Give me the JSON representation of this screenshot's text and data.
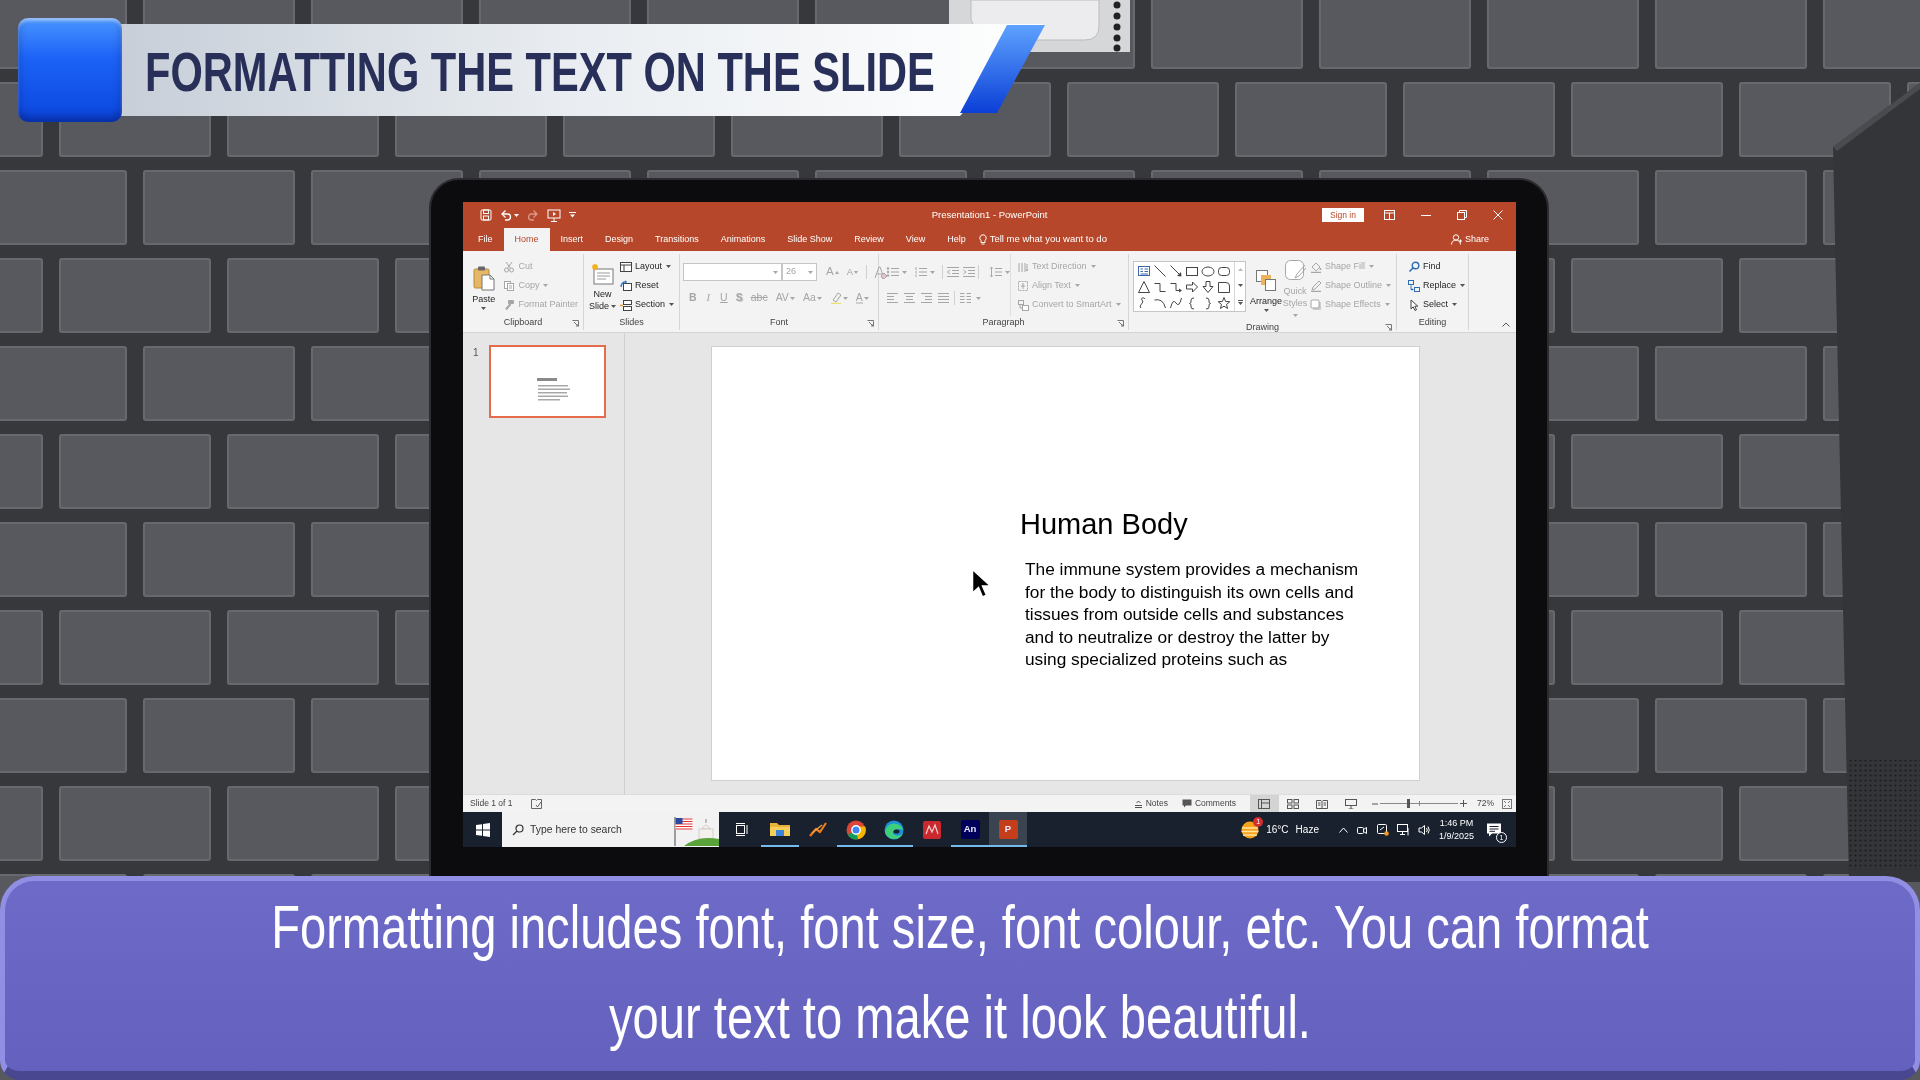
{
  "banner": {
    "title": "FORMATTING THE TEXT ON THE SLIDE"
  },
  "window": {
    "title": "Presentation1 - PowerPoint",
    "quick_access": [
      {
        "kind": "save",
        "disabled": false
      },
      {
        "kind": "undo",
        "disabled": false
      },
      {
        "kind": "redo",
        "disabled": true
      },
      {
        "kind": "present",
        "disabled": false
      },
      {
        "kind": "customize",
        "disabled": false
      }
    ],
    "sign_in": "Sign in",
    "tell_me": "Tell me what you want to do",
    "share": "Share"
  },
  "tabs": [
    {
      "label": "File",
      "selected": false
    },
    {
      "label": "Home",
      "selected": true
    },
    {
      "label": "Insert",
      "selected": false
    },
    {
      "label": "Design",
      "selected": false
    },
    {
      "label": "Transitions",
      "selected": false
    },
    {
      "label": "Animations",
      "selected": false
    },
    {
      "label": "Slide Show",
      "selected": false
    },
    {
      "label": "Review",
      "selected": false
    },
    {
      "label": "View",
      "selected": false
    },
    {
      "label": "Help",
      "selected": false
    }
  ],
  "ribbon": {
    "clipboard": {
      "label": "Clipboard",
      "launcher": true,
      "paste": {
        "label": "Paste",
        "disabled": false
      },
      "items": [
        {
          "kind": "cut",
          "label": "Cut",
          "disabled": true
        },
        {
          "kind": "copy",
          "label": "Copy",
          "disabled": true
        },
        {
          "kind": "painter",
          "label": "Format Painter",
          "disabled": true
        }
      ]
    },
    "slides": {
      "label": "Slides",
      "launcher": false,
      "new_slide": {
        "label": "New Slide",
        "disabled": false
      },
      "items": [
        {
          "kind": "layout",
          "label": "Layout",
          "disabled": false
        },
        {
          "kind": "reset",
          "label": "Reset",
          "disabled": false
        },
        {
          "kind": "section",
          "label": "Section",
          "disabled": false
        }
      ]
    },
    "font": {
      "label": "Font",
      "launcher": true,
      "disabled": true,
      "font_size": "26",
      "size_buttons": [
        {
          "kind": "grow",
          "glyph": "A"
        },
        {
          "kind": "shrink",
          "glyph": "A"
        }
      ],
      "buttons": [
        {
          "kind": "bold",
          "glyph": "B"
        },
        {
          "kind": "italic",
          "glyph": "I"
        },
        {
          "kind": "underline",
          "glyph": "U"
        },
        {
          "kind": "shadow",
          "glyph": "S"
        },
        {
          "kind": "strike",
          "glyph": "abc"
        },
        {
          "kind": "spacing",
          "glyph": "AV"
        },
        {
          "kind": "case",
          "glyph": "Aa"
        },
        {
          "kind": "highlight"
        },
        {
          "kind": "color",
          "glyph": "A"
        }
      ]
    },
    "paragraph": {
      "label": "Paragraph",
      "launcher": true,
      "disabled": true,
      "items": [
        {
          "kind": "direction",
          "label": "Text Direction"
        },
        {
          "kind": "align",
          "label": "Align Text"
        },
        {
          "kind": "smartart",
          "label": "Convert to SmartArt"
        }
      ]
    },
    "drawing": {
      "label": "Drawing",
      "launcher": true,
      "arrange": {
        "label": "Arrange",
        "disabled": false
      },
      "quick_styles": {
        "label": "Quick Styles",
        "disabled": true
      },
      "items": [
        {
          "kind": "fill",
          "label": "Shape Fill",
          "disabled": true
        },
        {
          "kind": "outline",
          "label": "Shape Outline",
          "disabled": true
        },
        {
          "kind": "effects",
          "label": "Shape Effects",
          "disabled": true
        }
      ]
    },
    "editing": {
      "label": "Editing",
      "launcher": false,
      "items": [
        {
          "kind": "find",
          "label": "Find",
          "disabled": false
        },
        {
          "kind": "replace",
          "label": "Replace",
          "disabled": false
        },
        {
          "kind": "select",
          "label": "Select",
          "disabled": false
        }
      ]
    }
  },
  "thumbnails": [
    {
      "number": "1",
      "selected": true
    }
  ],
  "slide": {
    "title": "Human Body",
    "body": "The immune system provides a mechanism for the body to distinguish its own cells and tissues from outside cells and substances and to neutralize or destroy the latter by using specialized proteins such as"
  },
  "status_bar": {
    "slide_info": "Slide 1 of 1",
    "notes": "Notes",
    "comments": "Comments",
    "views": [
      {
        "kind": "normal",
        "selected": true
      },
      {
        "kind": "sorter",
        "selected": false
      },
      {
        "kind": "reading",
        "selected": false
      },
      {
        "kind": "show",
        "selected": false
      }
    ],
    "zoom": {
      "level": 0.36,
      "reading": "72%"
    }
  },
  "taskbar": {
    "search": {
      "placeholder": "Type here to search"
    },
    "apps": [
      {
        "kind": "folder",
        "running": true,
        "selected": false
      },
      {
        "kind": "squiggle",
        "running": false,
        "selected": false
      },
      {
        "kind": "ring",
        "running": true,
        "selected": false
      },
      {
        "kind": "swirl",
        "running": true,
        "selected": false
      },
      {
        "kind": "redtile",
        "running": false,
        "selected": false
      },
      {
        "kind": "lettertile",
        "glyph": "An",
        "color": "#00005b",
        "running": true,
        "selected": false
      },
      {
        "kind": "lettertile",
        "glyph": "P",
        "color": "#c43e1c",
        "running": true,
        "selected": true
      }
    ],
    "weather": {
      "badge": "1",
      "temperature": "16°C",
      "condition": "Haze"
    },
    "clock": {
      "time": "1:46 PM",
      "date": "1/9/2025"
    },
    "notifications": {
      "badge": "1"
    }
  },
  "caption": "Formatting includes font, font size, font colour, etc. You can format your text to make it look beautiful."
}
